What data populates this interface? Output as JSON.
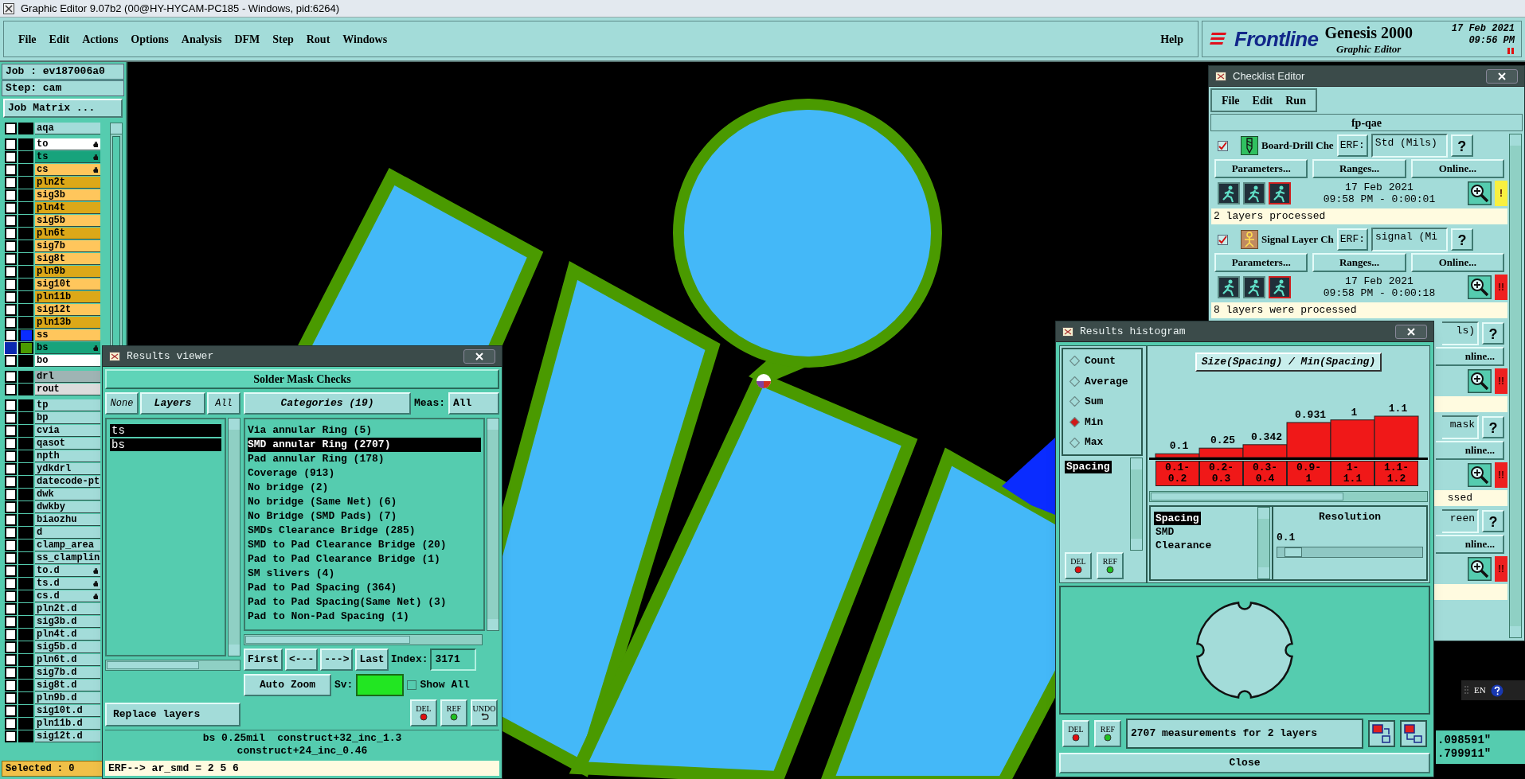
{
  "app_title": "Graphic Editor 9.07b2 (00@HY-HYCAM-PC185 - Windows, pid:6264)",
  "menu": [
    "File",
    "Edit",
    "Actions",
    "Options",
    "Analysis",
    "DFM",
    "Step",
    "Rout",
    "Windows"
  ],
  "help": "Help",
  "brand": {
    "logo": "Frontline",
    "product": "Genesis 2000",
    "subtitle": "Graphic Editor",
    "date": "17 Feb 2021",
    "time": "09:56 PM"
  },
  "job_panel": {
    "job_label": "Job : ev187006a0",
    "step_label": "Step: cam",
    "matrix_button": "Job Matrix ...",
    "layer_groups": [
      [
        {
          "name": "aqa",
          "color": "#a3dcd9",
          "selected": false,
          "marked": false
        }
      ],
      [
        {
          "name": "to",
          "color": "#ffffff",
          "selected": false,
          "marked": true
        },
        {
          "name": "ts",
          "color": "#17a37c",
          "selected": false,
          "marked": true
        },
        {
          "name": "cs",
          "color": "#ffc65c",
          "selected": false,
          "marked": true
        },
        {
          "name": "pln2t",
          "color": "#dca818",
          "selected": false,
          "marked": false
        },
        {
          "name": "sig3b",
          "color": "#ffc65c",
          "selected": false,
          "marked": false
        },
        {
          "name": "pln4t",
          "color": "#dca818",
          "selected": false,
          "marked": false
        },
        {
          "name": "sig5b",
          "color": "#ffc65c",
          "selected": false,
          "marked": false
        },
        {
          "name": "pln6t",
          "color": "#dca818",
          "selected": false,
          "marked": false
        },
        {
          "name": "sig7b",
          "color": "#ffc65c",
          "selected": false,
          "marked": false
        },
        {
          "name": "sig8t",
          "color": "#ffc65c",
          "selected": false,
          "marked": false
        },
        {
          "name": "pln9b",
          "color": "#dca818",
          "selected": false,
          "marked": false
        },
        {
          "name": "sig10t",
          "color": "#ffc65c",
          "selected": false,
          "marked": false
        },
        {
          "name": "pln11b",
          "color": "#dca818",
          "selected": false,
          "marked": false
        },
        {
          "name": "sig12t",
          "color": "#ffc65c",
          "selected": false,
          "marked": false
        },
        {
          "name": "pln13b",
          "color": "#dca818",
          "selected": false,
          "marked": false
        },
        {
          "name": "ss",
          "color": "#ffc65c",
          "selected": false,
          "marked": false,
          "display": {
            "color": "#0a2cff"
          }
        },
        {
          "name": "bs",
          "color": "#17a37c",
          "selected": true,
          "marked": true,
          "display": {
            "color": "#4a9a00"
          }
        },
        {
          "name": "bo",
          "color": "#ffffff",
          "selected": false,
          "marked": false
        }
      ],
      [
        {
          "name": "drl",
          "color": "#9fb4b4",
          "selected": false,
          "marked": false
        },
        {
          "name": "rout",
          "color": "#dcdcdc",
          "selected": false,
          "marked": false
        }
      ],
      [
        {
          "name": "tp",
          "color": "#a3dcd9",
          "selected": false,
          "marked": false
        },
        {
          "name": "bp",
          "color": "#a3dcd9",
          "selected": false,
          "marked": false
        },
        {
          "name": "cvia",
          "color": "#a3dcd9",
          "selected": false,
          "marked": false
        },
        {
          "name": "qasot",
          "color": "#a3dcd9",
          "selected": false,
          "marked": false
        },
        {
          "name": "npth",
          "color": "#a3dcd9",
          "selected": false,
          "marked": false
        },
        {
          "name": "ydkdrl",
          "color": "#a3dcd9",
          "selected": false,
          "marked": false
        },
        {
          "name": "datecode-pt",
          "color": "#a3dcd9",
          "selected": false,
          "marked": false
        },
        {
          "name": "dwk",
          "color": "#a3dcd9",
          "selected": false,
          "marked": false
        },
        {
          "name": "dwkby",
          "color": "#a3dcd9",
          "selected": false,
          "marked": false
        },
        {
          "name": "biaozhu",
          "color": "#a3dcd9",
          "selected": false,
          "marked": false
        },
        {
          "name": "d",
          "color": "#a3dcd9",
          "selected": false,
          "marked": false
        },
        {
          "name": "clamp_area",
          "color": "#a3dcd9",
          "selected": false,
          "marked": false
        },
        {
          "name": "ss_clamplin",
          "color": "#a3dcd9",
          "selected": false,
          "marked": false
        },
        {
          "name": "to.d",
          "color": "#a3dcd9",
          "selected": false,
          "marked": true
        },
        {
          "name": "ts.d",
          "color": "#a3dcd9",
          "selected": false,
          "marked": true
        },
        {
          "name": "cs.d",
          "color": "#a3dcd9",
          "selected": false,
          "marked": true
        },
        {
          "name": "pln2t.d",
          "color": "#a3dcd9",
          "selected": false,
          "marked": false
        },
        {
          "name": "sig3b.d",
          "color": "#a3dcd9",
          "selected": false,
          "marked": false
        },
        {
          "name": "pln4t.d",
          "color": "#a3dcd9",
          "selected": false,
          "marked": false
        },
        {
          "name": "sig5b.d",
          "color": "#a3dcd9",
          "selected": false,
          "marked": false
        },
        {
          "name": "pln6t.d",
          "color": "#a3dcd9",
          "selected": false,
          "marked": false
        },
        {
          "name": "sig7b.d",
          "color": "#a3dcd9",
          "selected": false,
          "marked": false
        },
        {
          "name": "sig8t.d",
          "color": "#a3dcd9",
          "selected": false,
          "marked": false
        },
        {
          "name": "pln9b.d",
          "color": "#a3dcd9",
          "selected": false,
          "marked": false
        },
        {
          "name": "sig10t.d",
          "color": "#a3dcd9",
          "selected": false,
          "marked": false
        },
        {
          "name": "pln11b.d",
          "color": "#a3dcd9",
          "selected": false,
          "marked": false
        },
        {
          "name": "sig12t.d",
          "color": "#a3dcd9",
          "selected": false,
          "marked": false
        }
      ]
    ],
    "selected_count": "Selected : 0"
  },
  "results_viewer": {
    "title": "Results viewer",
    "heading": "Solder Mask Checks",
    "layer_buttons": [
      "None",
      "Layers",
      "All"
    ],
    "layers": [
      {
        "name": "ts",
        "selected": true
      },
      {
        "name": "bs",
        "selected": true
      }
    ],
    "categories_header": "Categories (19)",
    "meas_label": "Meas:",
    "meas_value": "All",
    "categories": [
      {
        "label": "Via annular Ring (5)",
        "selected": false
      },
      {
        "label": "SMD annular Ring (2707)",
        "selected": true
      },
      {
        "label": "Pad annular Ring (178)",
        "selected": false
      },
      {
        "label": "Coverage (913)",
        "selected": false
      },
      {
        "label": "No bridge (2)",
        "selected": false
      },
      {
        "label": "No bridge (Same Net) (6)",
        "selected": false
      },
      {
        "label": "No Bridge (SMD Pads) (7)",
        "selected": false
      },
      {
        "label": "SMDs Clearance Bridge (285)",
        "selected": false
      },
      {
        "label": "SMD to Pad Clearance Bridge (20)",
        "selected": false
      },
      {
        "label": "Pad to Pad Clearance Bridge (1)",
        "selected": false
      },
      {
        "label": "SM slivers (4)",
        "selected": false
      },
      {
        "label": "Pad to Pad Spacing (364)",
        "selected": false
      },
      {
        "label": "Pad to Pad Spacing(Same Net) (3)",
        "selected": false
      },
      {
        "label": "Pad to Non-Pad Spacing (1)",
        "selected": false
      }
    ],
    "nav_buttons": [
      "First",
      "<---",
      "--->",
      "Last"
    ],
    "index_label": "Index:",
    "index_value": "3171",
    "zoom_mode": "Auto Zoom",
    "sv": {
      "label": "Sv:",
      "color": "#22e622"
    },
    "show_all": {
      "label": "Show All",
      "checked": false
    },
    "replace_button": "Replace layers",
    "action_buttons": [
      {
        "label": "DEL",
        "kind": "delete"
      },
      {
        "label": "REF",
        "kind": "refresh"
      },
      {
        "label": "UNDO",
        "kind": "undo"
      }
    ],
    "info_lines": [
      "bs 0.25mil  construct+32_inc_1.3",
      "construct+24_inc_0.46"
    ],
    "erf_line": "ERF--> ar_smd = 2 5 6"
  },
  "checklist_editor": {
    "title": "Checklist Editor",
    "menu": [
      "File",
      "Edit",
      "Run"
    ],
    "checklist_name": "fp-qae",
    "checks": [
      {
        "kind": "full",
        "enabled": true,
        "name": "Board-Drill Che",
        "erf_label": "ERF:",
        "erf_value": "Std (Mils)",
        "help": "?",
        "buttons": [
          "Parameters...",
          "Ranges...",
          "Online..."
        ],
        "date": "17 Feb 2021",
        "time": "09:58 PM - 0:00:01",
        "status": {
          "text": "!",
          "color": "#f8f040"
        },
        "message": "2 layers processed"
      },
      {
        "kind": "full",
        "enabled": true,
        "name": "Signal Layer Ch",
        "erf_label": "ERF:",
        "erf_value": "signal (Mi",
        "help": "?",
        "buttons": [
          "Parameters...",
          "Ranges...",
          "Online..."
        ],
        "date": "17 Feb 2021",
        "time": "09:58 PM - 0:00:18",
        "status": {
          "text": "!!",
          "color": "#ee2020"
        },
        "message": "8 layers were processed"
      },
      {
        "kind": "covered",
        "erf_value": "ls)",
        "help": "?",
        "online": "nline...",
        "status": {
          "text": "!!",
          "color": "#ee2020"
        }
      },
      {
        "kind": "covered",
        "erf_value": "mask",
        "help": "?",
        "online": "nline...",
        "status": {
          "text": "!!",
          "color": "#ee2020"
        },
        "message": "ssed"
      },
      {
        "kind": "covered",
        "erf_value": "reen",
        "help": "?",
        "online": "nline...",
        "status": {
          "text": "!!",
          "color": "#ee2020"
        }
      }
    ]
  },
  "histogram": {
    "title": "Results histogram",
    "modes": [
      {
        "label": "Count",
        "selected": false
      },
      {
        "label": "Average",
        "selected": false
      },
      {
        "label": "Sum",
        "selected": false
      },
      {
        "label": "Min",
        "selected": true
      },
      {
        "label": "Max",
        "selected": false
      }
    ],
    "measures": [
      {
        "label": "Spacing",
        "selected": true
      }
    ],
    "chart_title": "Size(Spacing) / Min(Spacing)",
    "chart_data": {
      "type": "bar",
      "categories": [
        "0.1-0.2",
        "0.2-0.3",
        "0.3-0.4",
        "0.9-1",
        "1-1.1",
        "1.1-1.2"
      ],
      "values": [
        0.1,
        0.25,
        0.342,
        0.931,
        1,
        1.1
      ],
      "data_labels": true
    },
    "types": [
      {
        "label": "Spacing",
        "selected": true
      },
      {
        "label": "SMD",
        "selected": false
      },
      {
        "label": "Clearance",
        "selected": false
      }
    ],
    "resolution_label": "Resolution",
    "resolution_value": "0.1",
    "resolution_slider": {
      "level": 0.05
    },
    "list_buttons": [
      {
        "label": "DEL",
        "kind": "delete"
      },
      {
        "label": "REF",
        "kind": "refresh"
      }
    ],
    "summary_buttons": [
      {
        "label": "DEL",
        "kind": "delete"
      },
      {
        "label": "REF",
        "kind": "refresh"
      }
    ],
    "summary": "2707 measurements for 2 layers",
    "close": "Close"
  },
  "coordinates": [
    ".098591\"",
    ".799911\""
  ],
  "language_bar": {
    "label": "EN"
  }
}
